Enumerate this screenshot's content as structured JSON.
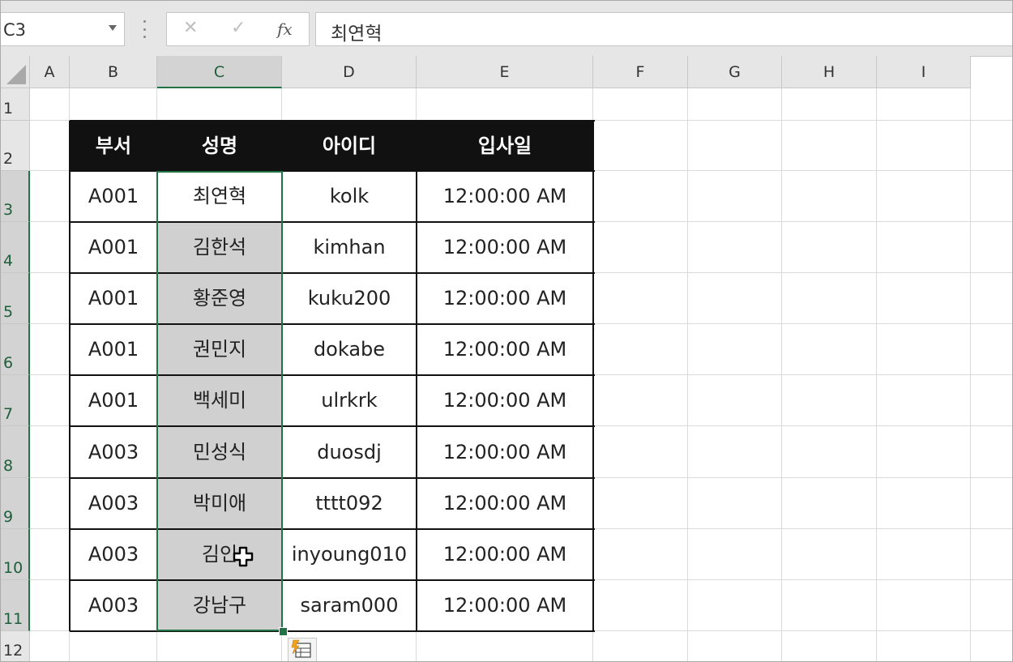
{
  "formula_bar": {
    "name_box": "C3",
    "cancel_symbol": "✕",
    "enter_symbol": "✓",
    "fx_symbol": "fx",
    "formula": "최연혁"
  },
  "columns": [
    "A",
    "B",
    "C",
    "D",
    "E",
    "F",
    "G",
    "H",
    "I"
  ],
  "rows": [
    "1",
    "2",
    "3",
    "4",
    "5",
    "6",
    "7",
    "8",
    "9",
    "10",
    "11",
    "12"
  ],
  "table": {
    "headers": [
      "부서",
      "성명",
      "아이디",
      "입사일"
    ],
    "rows": [
      [
        "A001",
        "최연혁",
        "kolk",
        "12:00:00 AM"
      ],
      [
        "A001",
        "김한석",
        "kimhan",
        "12:00:00 AM"
      ],
      [
        "A001",
        "황준영",
        "kuku200",
        "12:00:00 AM"
      ],
      [
        "A001",
        "권민지",
        "dokabe",
        "12:00:00 AM"
      ],
      [
        "A001",
        "백세미",
        "ulrkrk",
        "12:00:00 AM"
      ],
      [
        "A003",
        "민성식",
        "duosdj",
        "12:00:00 AM"
      ],
      [
        "A003",
        "박미애",
        "tttt092",
        "12:00:00 AM"
      ],
      [
        "A003",
        "김인",
        "inyoung010",
        "12:00:00 AM"
      ],
      [
        "A003",
        "강남구",
        "saram000",
        "12:00:00 AM"
      ]
    ]
  },
  "selection": {
    "active_cell": "C3",
    "range": "C3:C11"
  },
  "colors": {
    "selection": "#217346",
    "header_fill": "#111111",
    "highlight_fill": "#d0d0d0"
  }
}
